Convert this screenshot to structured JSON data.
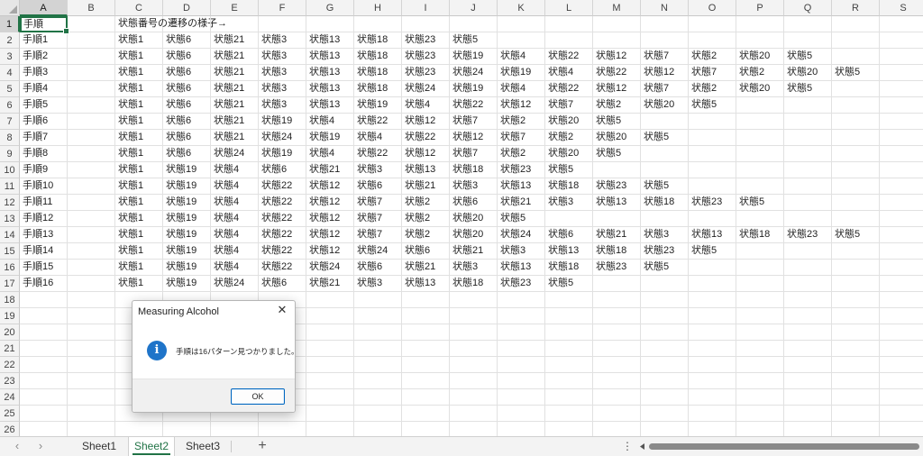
{
  "columns": [
    "A",
    "B",
    "C",
    "D",
    "E",
    "F",
    "G",
    "H",
    "I",
    "J",
    "K",
    "L",
    "M",
    "N",
    "O",
    "P",
    "Q",
    "R",
    "S"
  ],
  "row_numbers": [
    "1",
    "2",
    "3",
    "4",
    "5",
    "6",
    "7",
    "8",
    "9",
    "10",
    "11",
    "12",
    "13",
    "14",
    "15",
    "16",
    "17",
    "18",
    "19",
    "20",
    "21",
    "22",
    "23",
    "24",
    "25",
    "26"
  ],
  "active_cell": "A1",
  "rows": [
    {
      "a": "手順",
      "c": [
        "状態番号の遷移の様子→"
      ]
    },
    {
      "a": "手順1",
      "c": [
        "状態1",
        "状態6",
        "状態21",
        "状態3",
        "状態13",
        "状態18",
        "状態23",
        "状態5"
      ]
    },
    {
      "a": "手順2",
      "c": [
        "状態1",
        "状態6",
        "状態21",
        "状態3",
        "状態13",
        "状態18",
        "状態23",
        "状態19",
        "状態4",
        "状態22",
        "状態12",
        "状態7",
        "状態2",
        "状態20",
        "状態5"
      ]
    },
    {
      "a": "手順3",
      "c": [
        "状態1",
        "状態6",
        "状態21",
        "状態3",
        "状態13",
        "状態18",
        "状態23",
        "状態24",
        "状態19",
        "状態4",
        "状態22",
        "状態12",
        "状態7",
        "状態2",
        "状態20",
        "状態5"
      ]
    },
    {
      "a": "手順4",
      "c": [
        "状態1",
        "状態6",
        "状態21",
        "状態3",
        "状態13",
        "状態18",
        "状態24",
        "状態19",
        "状態4",
        "状態22",
        "状態12",
        "状態7",
        "状態2",
        "状態20",
        "状態5"
      ]
    },
    {
      "a": "手順5",
      "c": [
        "状態1",
        "状態6",
        "状態21",
        "状態3",
        "状態13",
        "状態19",
        "状態4",
        "状態22",
        "状態12",
        "状態7",
        "状態2",
        "状態20",
        "状態5"
      ]
    },
    {
      "a": "手順6",
      "c": [
        "状態1",
        "状態6",
        "状態21",
        "状態19",
        "状態4",
        "状態22",
        "状態12",
        "状態7",
        "状態2",
        "状態20",
        "状態5"
      ]
    },
    {
      "a": "手順7",
      "c": [
        "状態1",
        "状態6",
        "状態21",
        "状態24",
        "状態19",
        "状態4",
        "状態22",
        "状態12",
        "状態7",
        "状態2",
        "状態20",
        "状態5"
      ]
    },
    {
      "a": "手順8",
      "c": [
        "状態1",
        "状態6",
        "状態24",
        "状態19",
        "状態4",
        "状態22",
        "状態12",
        "状態7",
        "状態2",
        "状態20",
        "状態5"
      ]
    },
    {
      "a": "手順9",
      "c": [
        "状態1",
        "状態19",
        "状態4",
        "状態6",
        "状態21",
        "状態3",
        "状態13",
        "状態18",
        "状態23",
        "状態5"
      ]
    },
    {
      "a": "手順10",
      "c": [
        "状態1",
        "状態19",
        "状態4",
        "状態22",
        "状態12",
        "状態6",
        "状態21",
        "状態3",
        "状態13",
        "状態18",
        "状態23",
        "状態5"
      ]
    },
    {
      "a": "手順11",
      "c": [
        "状態1",
        "状態19",
        "状態4",
        "状態22",
        "状態12",
        "状態7",
        "状態2",
        "状態6",
        "状態21",
        "状態3",
        "状態13",
        "状態18",
        "状態23",
        "状態5"
      ]
    },
    {
      "a": "手順12",
      "c": [
        "状態1",
        "状態19",
        "状態4",
        "状態22",
        "状態12",
        "状態7",
        "状態2",
        "状態20",
        "状態5"
      ]
    },
    {
      "a": "手順13",
      "c": [
        "状態1",
        "状態19",
        "状態4",
        "状態22",
        "状態12",
        "状態7",
        "状態2",
        "状態20",
        "状態24",
        "状態6",
        "状態21",
        "状態3",
        "状態13",
        "状態18",
        "状態23",
        "状態5"
      ]
    },
    {
      "a": "手順14",
      "c": [
        "状態1",
        "状態19",
        "状態4",
        "状態22",
        "状態12",
        "状態24",
        "状態6",
        "状態21",
        "状態3",
        "状態13",
        "状態18",
        "状態23",
        "状態5"
      ]
    },
    {
      "a": "手順15",
      "c": [
        "状態1",
        "状態19",
        "状態4",
        "状態22",
        "状態24",
        "状態6",
        "状態21",
        "状態3",
        "状態13",
        "状態18",
        "状態23",
        "状態5"
      ]
    },
    {
      "a": "手順16",
      "c": [
        "状態1",
        "状態19",
        "状態24",
        "状態6",
        "状態21",
        "状態3",
        "状態13",
        "状態18",
        "状態23",
        "状態5"
      ]
    }
  ],
  "sheet_tabs": [
    {
      "label": "Sheet1",
      "active": false
    },
    {
      "label": "Sheet2",
      "active": true
    },
    {
      "label": "Sheet3",
      "active": false
    }
  ],
  "tabbar": {
    "prev_icon": "‹",
    "next_icon": "›",
    "add_icon": "+",
    "more_icon": "⋮"
  },
  "dialog": {
    "title": "Measuring Alcohol",
    "message": "手順は16パターン見つかりました。",
    "icon": "i",
    "ok_label": "OK",
    "close_icon": "✕"
  },
  "colors": {
    "accent": "#217346",
    "info_icon": "#1f74c9",
    "ok_border": "#0067c0"
  }
}
